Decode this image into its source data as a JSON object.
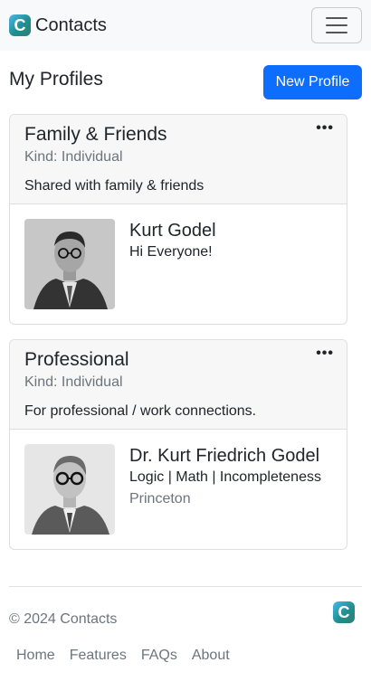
{
  "app": {
    "brand": "Contacts",
    "logo_letter": "C"
  },
  "page": {
    "title": "My Profiles",
    "new_profile_label": "New Profile"
  },
  "profiles": [
    {
      "title": "Family & Friends",
      "kind": "Kind: Individual",
      "description": "Shared with family & friends",
      "menu_label": "•••",
      "contact": {
        "name": "Kurt Godel",
        "tagline": "Hi Everyone!"
      }
    },
    {
      "title": "Professional",
      "kind": "Kind: Individual",
      "description": "For professional / work connections.",
      "menu_label": "•••",
      "contact": {
        "name": "Dr. Kurt Friedrich Godel",
        "tagline": "Logic | Math | Incompleteness",
        "org": "Princeton"
      }
    }
  ],
  "footer": {
    "copyright": "© 2024 Contacts",
    "links": [
      "Home",
      "Features",
      "FAQs",
      "About"
    ]
  },
  "colors": {
    "primary": "#0d6efd",
    "muted": "#6c757d",
    "navbar_bg": "#f8f9fa"
  }
}
